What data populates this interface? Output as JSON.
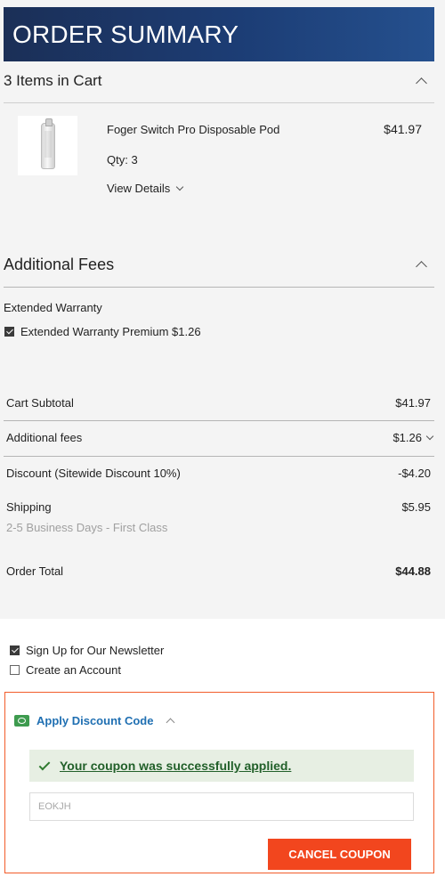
{
  "header": {
    "title": "ORDER SUMMARY"
  },
  "cart": {
    "title": "3 Items in Cart",
    "item": {
      "name": "Foger Switch Pro Disposable Pod",
      "qty": "Qty: 3",
      "price": "$41.97",
      "details_label": "View Details"
    }
  },
  "fees": {
    "title": "Additional Fees",
    "group_label": "Extended Warranty",
    "option_label": "Extended Warranty Premium $1.26",
    "option_checked": true
  },
  "totals": {
    "subtotal_label": "Cart Subtotal",
    "subtotal_value": "$41.97",
    "fees_label": "Additional fees",
    "fees_value": "$1.26",
    "discount_label": "Discount (Sitewide Discount 10%)",
    "discount_value": "-$4.20",
    "shipping_label": "Shipping",
    "shipping_value": "$5.95",
    "shipping_method": "2-5 Business Days - First Class",
    "order_total_label": "Order Total",
    "order_total_value": "$44.88"
  },
  "options": {
    "newsletter_label": "Sign Up for Our Newsletter",
    "newsletter_checked": true,
    "account_label": "Create an Account",
    "account_checked": false
  },
  "coupon": {
    "toggle_label": "Apply Discount Code",
    "success_message": "Your coupon was successfully applied.",
    "code_value": "EOKJH",
    "cancel_label": "CANCEL COUPON"
  },
  "colors": {
    "header_bg": "#1c3d75",
    "accent_button": "#f2461e",
    "success_bg": "#e7efe3",
    "success_text": "#22602a",
    "link": "#1f6fb2"
  }
}
